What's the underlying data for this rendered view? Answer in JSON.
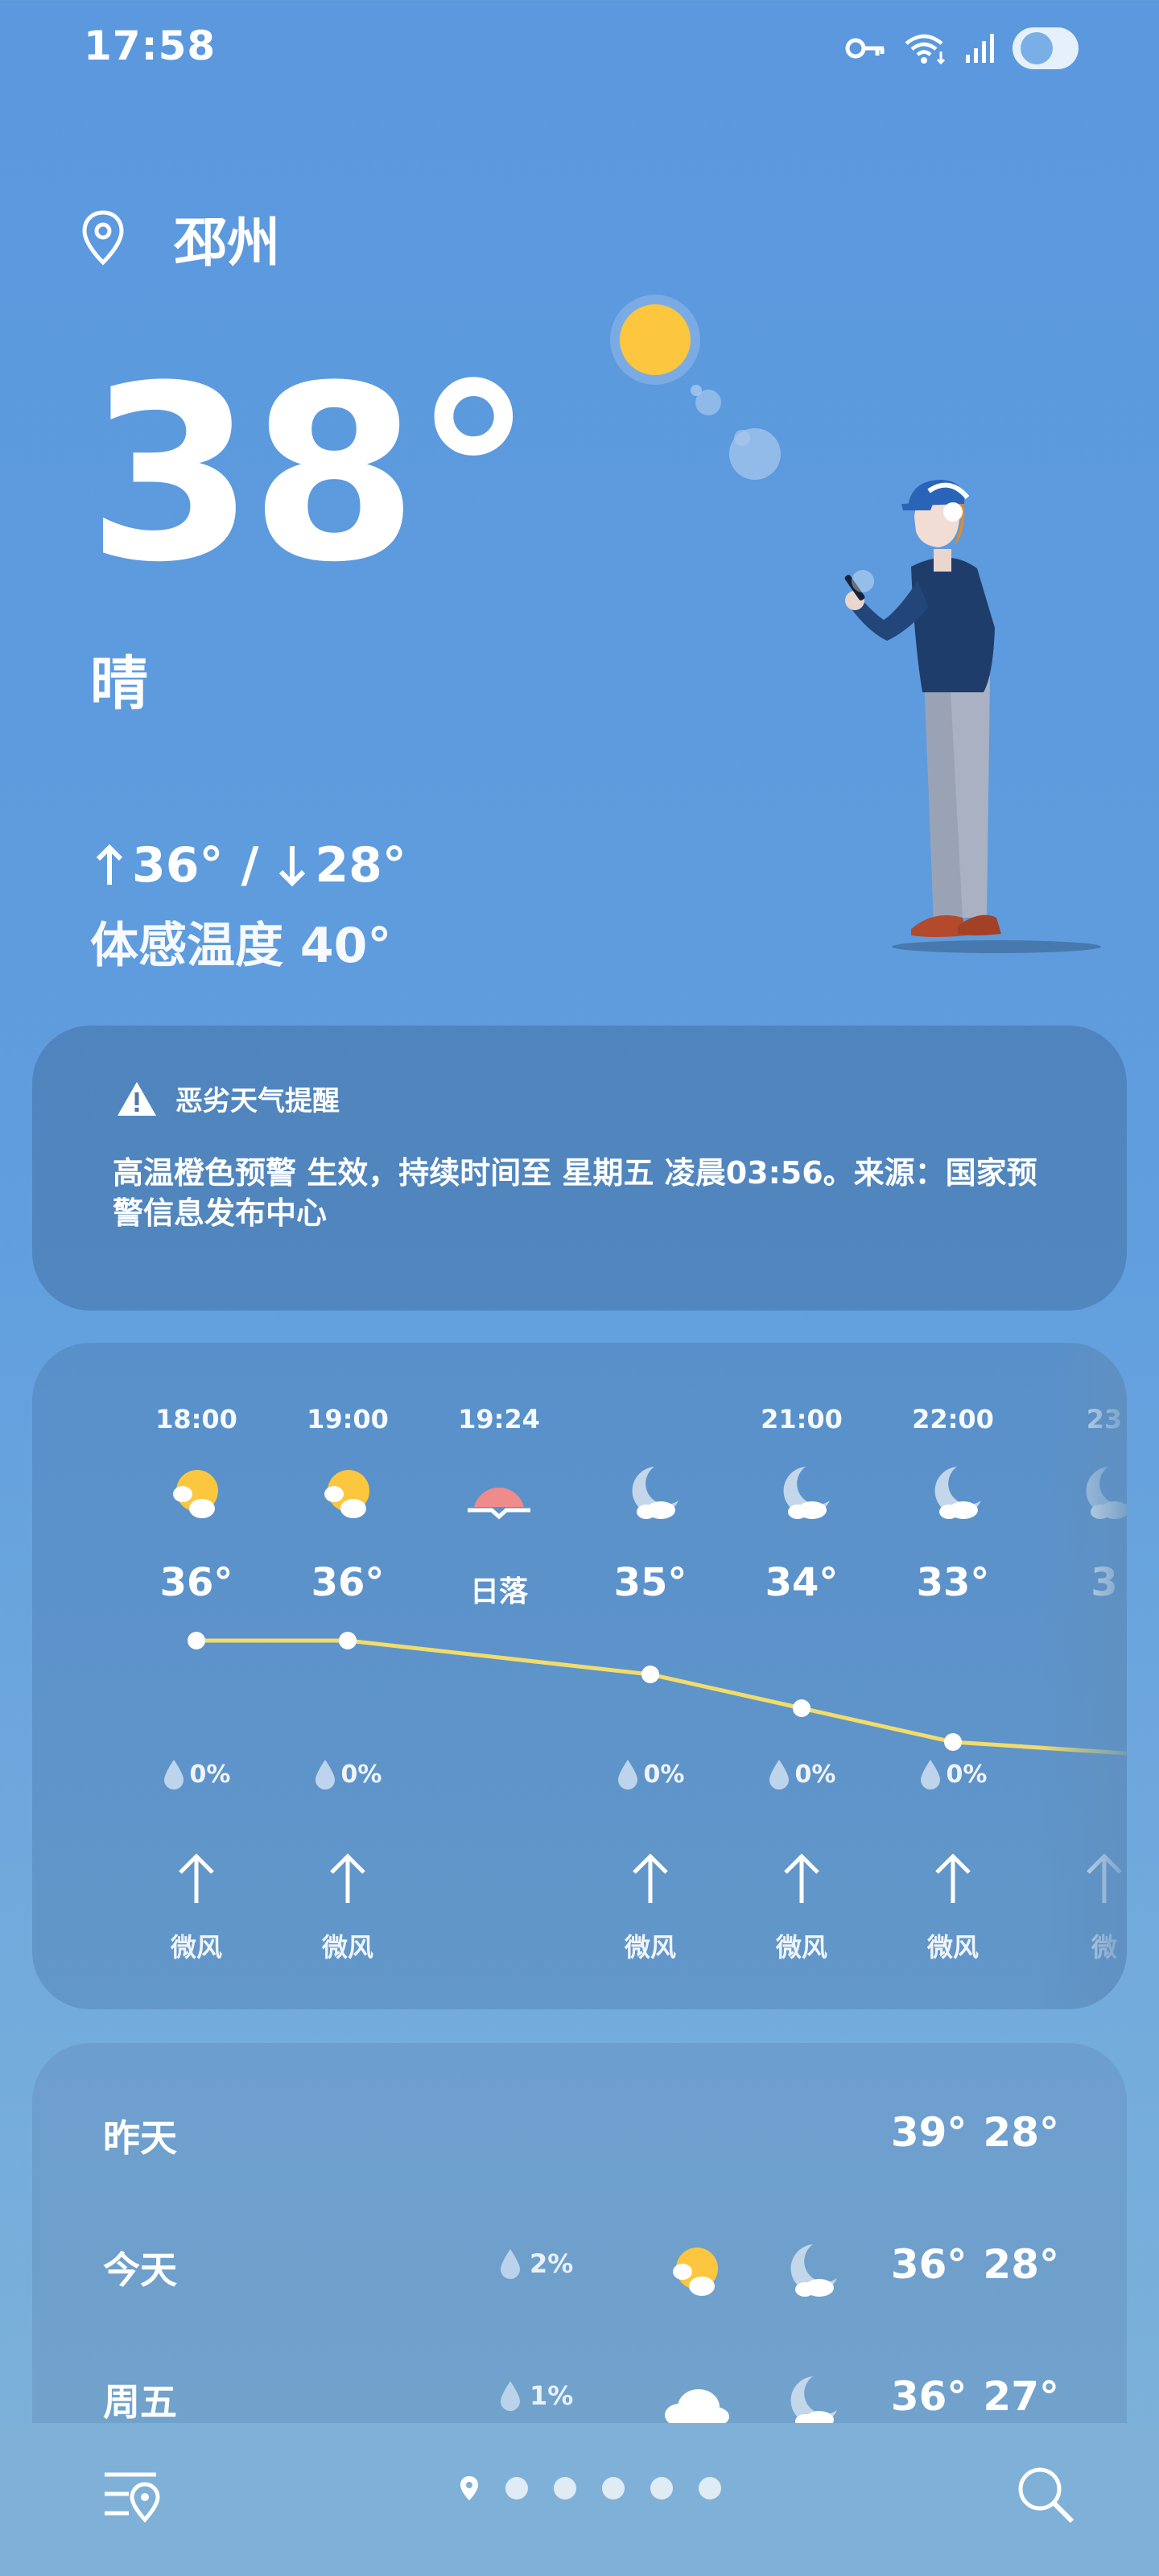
{
  "status": {
    "time": "17:58"
  },
  "header": {
    "city": "邳州",
    "temperature": "38°",
    "condition": "晴",
    "high": "36°",
    "low": "28°",
    "separator": "/",
    "feels_like": "体感温度 40°"
  },
  "alert": {
    "title": "恶劣天气提醒",
    "message": "高温橙色预警 生效，持续时间至 星期五 凌晨03:56。来源：国家预警信息发布中心"
  },
  "hourly": [
    {
      "time": "18:00",
      "icon": "sun-cloud-icon",
      "temp": "36°",
      "rain": "0%",
      "wind": "微风"
    },
    {
      "time": "19:00",
      "icon": "sun-cloud-icon",
      "temp": "36°",
      "rain": "0%",
      "wind": "微风"
    },
    {
      "time": "19:24",
      "icon": "sunset-icon",
      "temp": "日落",
      "rain": "",
      "wind": ""
    },
    {
      "time": "",
      "icon": "moon-cloud-icon",
      "temp": "35°",
      "rain": "0%",
      "wind": "微风"
    },
    {
      "time": "21:00",
      "icon": "moon-cloud-icon",
      "temp": "34°",
      "rain": "0%",
      "wind": "微风"
    },
    {
      "time": "22:00",
      "icon": "moon-cloud-icon",
      "temp": "33°",
      "rain": "0%",
      "wind": "微风"
    },
    {
      "time": "23",
      "icon": "moon-cloud-icon",
      "temp": "3",
      "rain": "",
      "wind": "微"
    }
  ],
  "daily": [
    {
      "day": "昨天",
      "rain": "",
      "high": "39°",
      "low": "28°"
    },
    {
      "day": "今天",
      "rain": "2%",
      "icon_day": "sun-cloud-icon",
      "icon_night": "moon-cloud-icon",
      "high": "36°",
      "low": "28°"
    },
    {
      "day": "周五",
      "rain": "1%",
      "icon_day": "cloud-icon",
      "icon_night": "moon-cloud-icon",
      "high": "36°",
      "low": "27°"
    }
  ],
  "colors": {
    "sun": "#fcc63e",
    "sunset": "#ef8b8b",
    "temp_line": "#f2dc6a",
    "background_top": "#5b98de"
  }
}
